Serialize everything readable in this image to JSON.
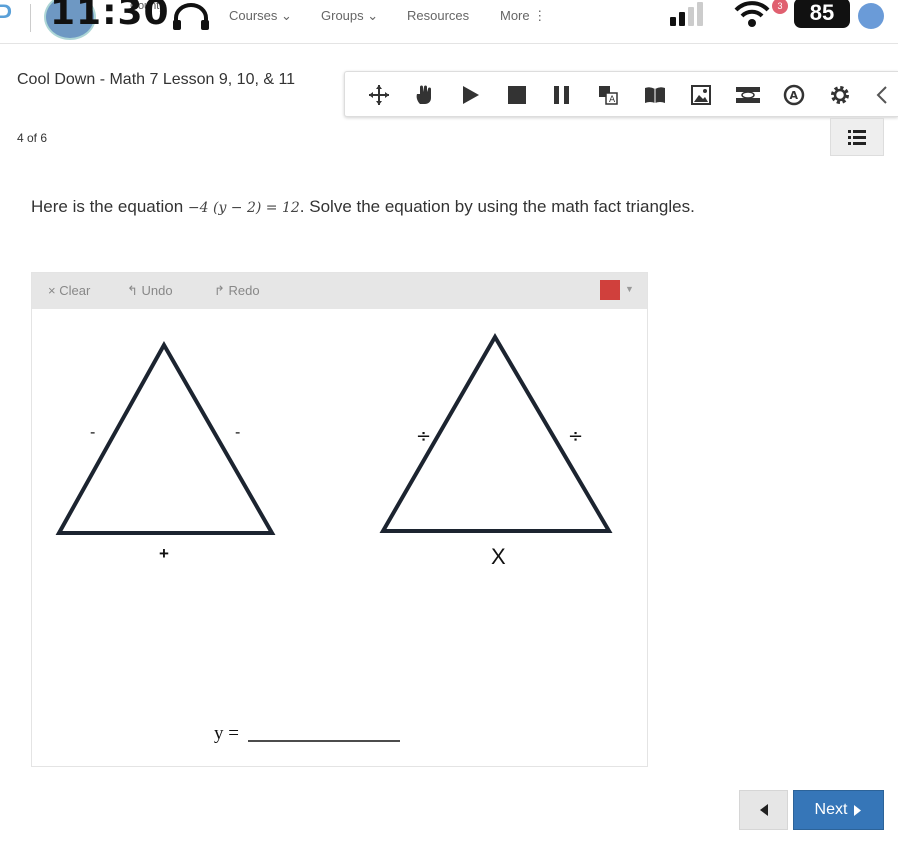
{
  "status_bar": {
    "time": "11:30",
    "school_text": "County",
    "battery": "85",
    "notification_count": "3"
  },
  "top_nav": {
    "items": [
      {
        "label": "Courses",
        "caret": "⌄"
      },
      {
        "label": "Groups",
        "caret": "⌄"
      },
      {
        "label": "Resources",
        "caret": ""
      },
      {
        "label": "More",
        "caret": "⋮"
      }
    ]
  },
  "assessment": {
    "title": "Cool Down - Math 7 Lesson 9, 10, & 11",
    "progress": "4 of 6"
  },
  "toolbar": {
    "tools": [
      "move-icon",
      "hand-pointer-icon",
      "play-icon",
      "stop-icon",
      "pause-icon",
      "translate-icon",
      "book-icon",
      "image-icon",
      "eye-mask-icon",
      "accessibility-icon",
      "gear-icon",
      "collapse-chevron-icon"
    ]
  },
  "question": {
    "prefix": "Here is the equation ",
    "equation": "−4 (y − 2) = 12",
    "suffix": ". Solve the equation by using the math fact triangles."
  },
  "sketch": {
    "clear_label": "× Clear",
    "undo_label": "Undo",
    "redo_label": "Redo",
    "pen_color": "#d0403c",
    "left_triangle": {
      "left": "-",
      "right": "-",
      "bottom": "+"
    },
    "right_triangle": {
      "left": "÷",
      "right": "÷",
      "bottom": "X"
    },
    "answer_label": "y ="
  },
  "navigation": {
    "next_label": "Next"
  },
  "colors": {
    "primary": "#3676b8",
    "pen": "#d0403c",
    "triangle_stroke": "#1c2430"
  }
}
